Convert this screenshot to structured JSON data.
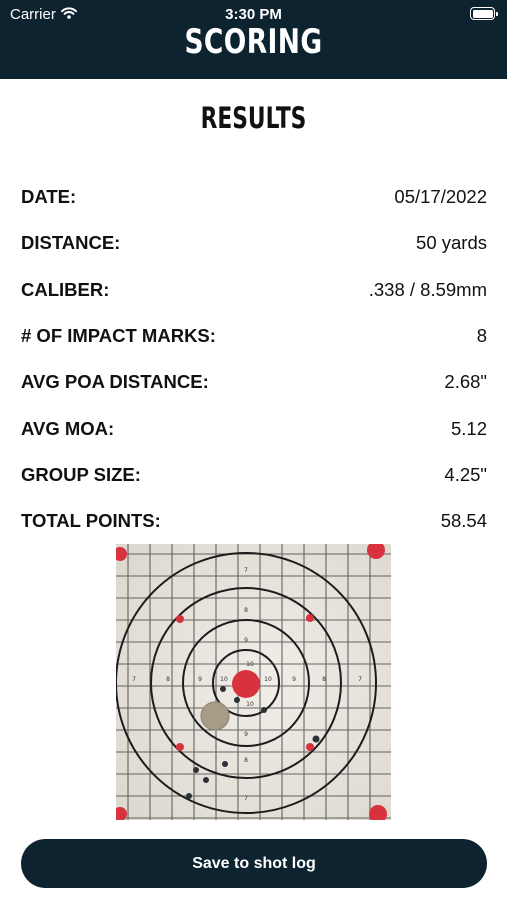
{
  "status_bar": {
    "carrier": "Carrier",
    "time": "3:30 PM"
  },
  "header": {
    "title": "SCORING"
  },
  "results": {
    "title": "RESULTS",
    "rows": [
      {
        "label": "DATE:",
        "value": "05/17/2022"
      },
      {
        "label": "DISTANCE:",
        "value": "50 yards"
      },
      {
        "label": "CALIBER:",
        "value": ".338 / 8.59mm"
      },
      {
        "label": "# OF IMPACT MARKS:",
        "value": "8"
      },
      {
        "label": "AVG POA DISTANCE:",
        "value": "2.68\""
      },
      {
        "label": "AVG MOA:",
        "value": "5.12"
      },
      {
        "label": "GROUP SIZE:",
        "value": "4.25\""
      },
      {
        "label": "TOTAL POINTS:",
        "value": "58.54"
      }
    ]
  },
  "target": {
    "ring_numbers": [
      "7",
      "8",
      "9",
      "10"
    ]
  },
  "actions": {
    "save_label": "Save to shot log"
  },
  "colors": {
    "header_bg": "#0d2330",
    "bullseye": "#d9323f",
    "paper": "#eeeae3"
  }
}
